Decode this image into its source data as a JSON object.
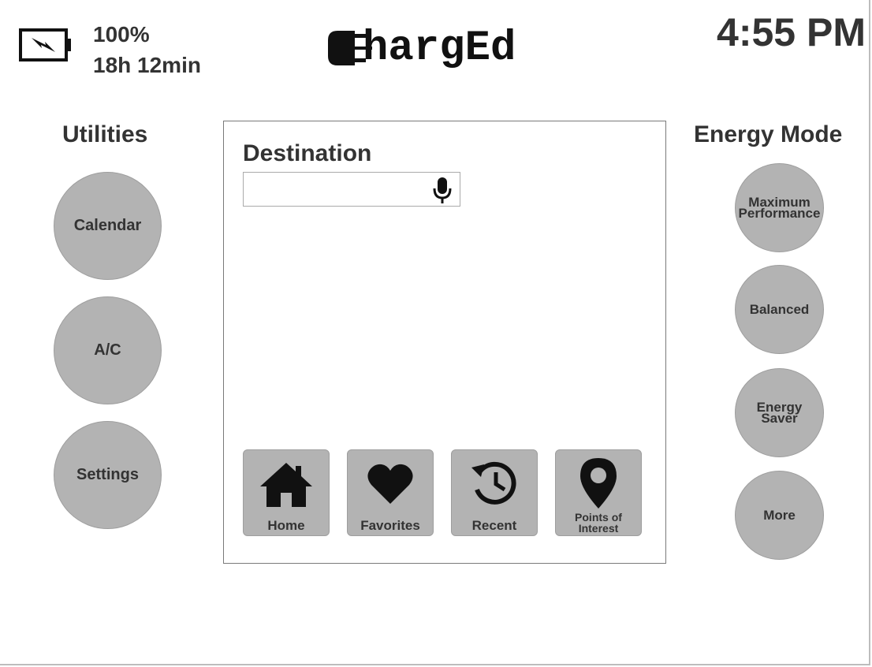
{
  "status": {
    "battery_percent": "100%",
    "battery_time": "18h 12min",
    "battery_icon": "battery-charging-icon"
  },
  "logo": {
    "icon": "plug-icon",
    "text": "hargEd"
  },
  "clock": "4:55 PM",
  "utilities": {
    "title": "Utilities",
    "items": [
      {
        "label": "Calendar"
      },
      {
        "label": "A/C"
      },
      {
        "label": "Settings"
      }
    ]
  },
  "destination": {
    "title": "Destination",
    "input_value": "",
    "input_placeholder": "",
    "mic_icon": "microphone-icon",
    "shortcuts": [
      {
        "label": "Home",
        "icon": "home-icon"
      },
      {
        "label": "Favorites",
        "icon": "heart-icon"
      },
      {
        "label": "Recent",
        "icon": "history-icon"
      },
      {
        "label": "Points of",
        "label2": "Interest",
        "icon": "map-pin-icon"
      }
    ]
  },
  "energy_mode": {
    "title": "Energy Mode",
    "items": [
      {
        "label": "Maximum",
        "label2": "Performance"
      },
      {
        "label": "Balanced"
      },
      {
        "label": "Energy",
        "label2": "Saver"
      },
      {
        "label": "More"
      }
    ]
  },
  "colors": {
    "button_fill": "#b3b3b3",
    "text": "#333333",
    "panel_border": "#7a7a7a"
  }
}
